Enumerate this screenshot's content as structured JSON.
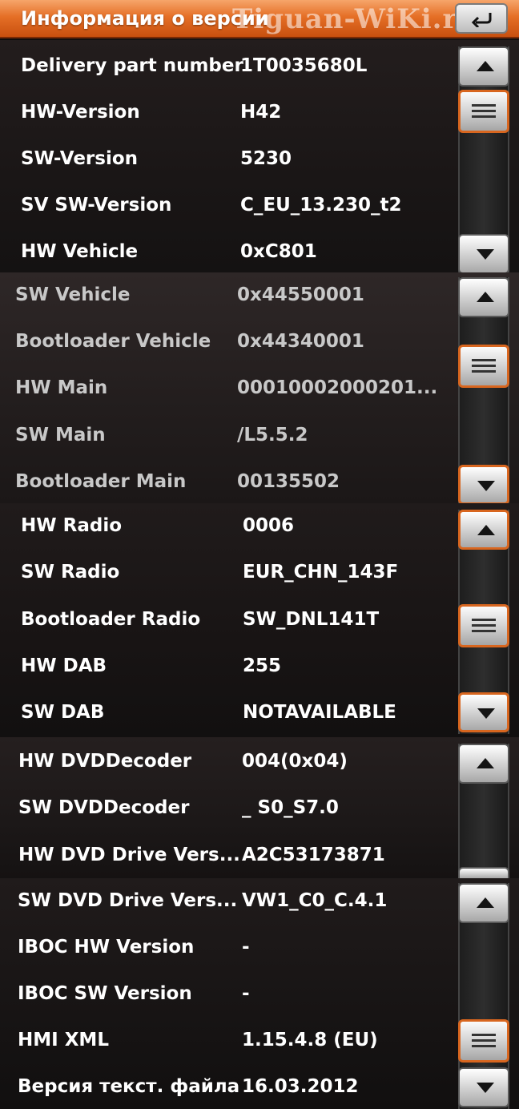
{
  "header": {
    "title": "Информация о версии",
    "watermark": "Tiguan-WiKi.ru",
    "back_icon": "back-arrow-icon"
  },
  "colors": {
    "accent": "#e56f26",
    "text": "#ffffff",
    "background": "#151313"
  },
  "panels": [
    {
      "rows": [
        {
          "label": "Delivery part number",
          "value": "1T0035680L"
        },
        {
          "label": "HW-Version",
          "value": "H42"
        },
        {
          "label": "SW-Version",
          "value": "5230"
        },
        {
          "label": "SV SW-Version",
          "value": "C_EU_13.230_t2"
        },
        {
          "label": "HW Vehicle",
          "value": "0xC801"
        }
      ]
    },
    {
      "rows": [
        {
          "label": "SW Vehicle",
          "value": "0x44550001"
        },
        {
          "label": "Bootloader Vehicle",
          "value": "0x44340001"
        },
        {
          "label": "HW Main",
          "value": "00010002000201..."
        },
        {
          "label": "SW Main",
          "value": "/L5.5.2"
        },
        {
          "label": "Bootloader Main",
          "value": "00135502"
        }
      ]
    },
    {
      "rows": [
        {
          "label": "HW Radio",
          "value": "0006"
        },
        {
          "label": "SW Radio",
          "value": "EUR_CHN_143F"
        },
        {
          "label": "Bootloader Radio",
          "value": "SW_DNL141T"
        },
        {
          "label": "HW DAB",
          "value": "255"
        },
        {
          "label": "SW DAB",
          "value": "NOTAVAILABLE"
        }
      ]
    },
    {
      "rows": [
        {
          "label": "HW DVDDecoder",
          "value": "004(0x04)"
        },
        {
          "label": "SW DVDDecoder",
          "value": "_ S0_S7.0"
        },
        {
          "label": "HW DVD Drive Vers...",
          "value": "A2C53173871"
        }
      ]
    },
    {
      "rows": [
        {
          "label": "SW DVD Drive Vers...",
          "value": "VW1_C0_C.4.1"
        },
        {
          "label": "IBOC HW Version",
          "value": "-"
        },
        {
          "label": "IBOC SW Version",
          "value": "-"
        },
        {
          "label": "HMI XML",
          "value": "1.15.4.8 (EU)"
        },
        {
          "label": "Версия текст. файла",
          "value": "16.03.2012"
        }
      ]
    }
  ],
  "scrollbar": {
    "up_icon": "arrow-up-icon",
    "down_icon": "arrow-down-icon",
    "thumb_icon": "grip-lines-icon"
  }
}
